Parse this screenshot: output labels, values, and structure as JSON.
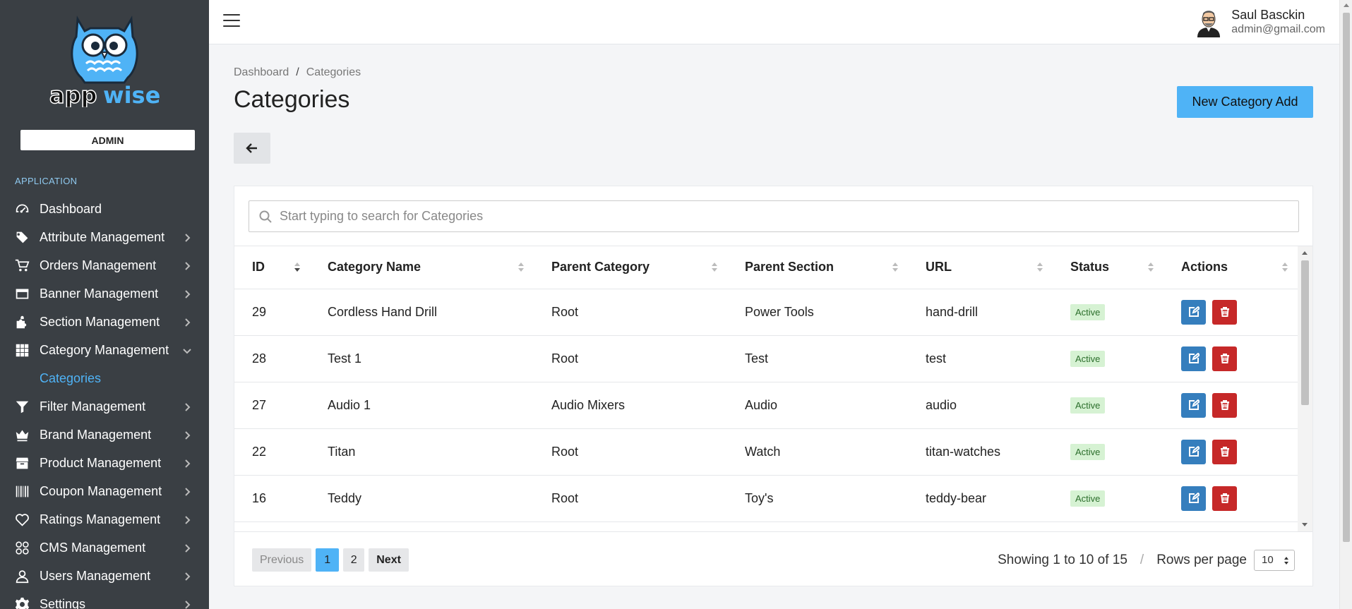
{
  "app": {
    "logo_text_left": "app",
    "logo_text_right": "wise",
    "role_badge": "ADMIN",
    "brand_color": "#4fb3f6"
  },
  "sidebar": {
    "section_label": "APPLICATION",
    "items": [
      {
        "label": "Dashboard",
        "icon": "gauge-icon",
        "has_children": false
      },
      {
        "label": "Attribute Management",
        "icon": "tags-icon",
        "has_children": true
      },
      {
        "label": "Orders Management",
        "icon": "cart-icon",
        "has_children": true
      },
      {
        "label": "Banner Management",
        "icon": "card-icon",
        "has_children": true
      },
      {
        "label": "Section Management",
        "icon": "puzzle-icon",
        "has_children": true
      },
      {
        "label": "Category Management",
        "icon": "grid-icon",
        "has_children": true,
        "expanded": true
      },
      {
        "label": "Filter Management",
        "icon": "filter-icon",
        "has_children": true
      },
      {
        "label": "Brand Management",
        "icon": "crown-icon",
        "has_children": true
      },
      {
        "label": "Product Management",
        "icon": "box-icon",
        "has_children": true
      },
      {
        "label": "Coupon Management",
        "icon": "barcode-icon",
        "has_children": true
      },
      {
        "label": "Ratings Management",
        "icon": "heart-icon",
        "has_children": true
      },
      {
        "label": "CMS Management",
        "icon": "circles-icon",
        "has_children": true
      },
      {
        "label": "Users Management",
        "icon": "user-icon",
        "has_children": true
      },
      {
        "label": "Settings",
        "icon": "gear-icon",
        "has_children": true
      }
    ],
    "sub_item": "Categories"
  },
  "user": {
    "name": "Saul Basckin",
    "email": "admin@gmail.com"
  },
  "breadcrumb": {
    "home": "Dashboard",
    "current": "Categories"
  },
  "page": {
    "title": "Categories",
    "new_button": "New Category Add"
  },
  "search": {
    "placeholder": "Start typing to search for Categories"
  },
  "table": {
    "columns": [
      "ID",
      "Category Name",
      "Parent Category",
      "Parent Section",
      "URL",
      "Status",
      "Actions"
    ],
    "rows": [
      {
        "id": "29",
        "name": "Cordless Hand Drill",
        "parent": "Root",
        "section": "Power Tools",
        "url": "hand-drill",
        "status": "Active"
      },
      {
        "id": "28",
        "name": "Test 1",
        "parent": "Root",
        "section": "Test",
        "url": "test",
        "status": "Active"
      },
      {
        "id": "27",
        "name": "Audio 1",
        "parent": "Audio Mixers",
        "section": "Audio",
        "url": "audio",
        "status": "Active"
      },
      {
        "id": "22",
        "name": "Titan",
        "parent": "Root",
        "section": "Watch",
        "url": "titan-watches",
        "status": "Active"
      },
      {
        "id": "16",
        "name": "Teddy",
        "parent": "Root",
        "section": "Toy's",
        "url": "teddy-bear",
        "status": "Active"
      }
    ]
  },
  "pagination": {
    "previous": "Previous",
    "pages": [
      "1",
      "2"
    ],
    "next": "Next",
    "showing": "Showing 1 to 10 of 15",
    "separator": "/",
    "rows_label": "Rows per page",
    "rows_value": "10"
  }
}
